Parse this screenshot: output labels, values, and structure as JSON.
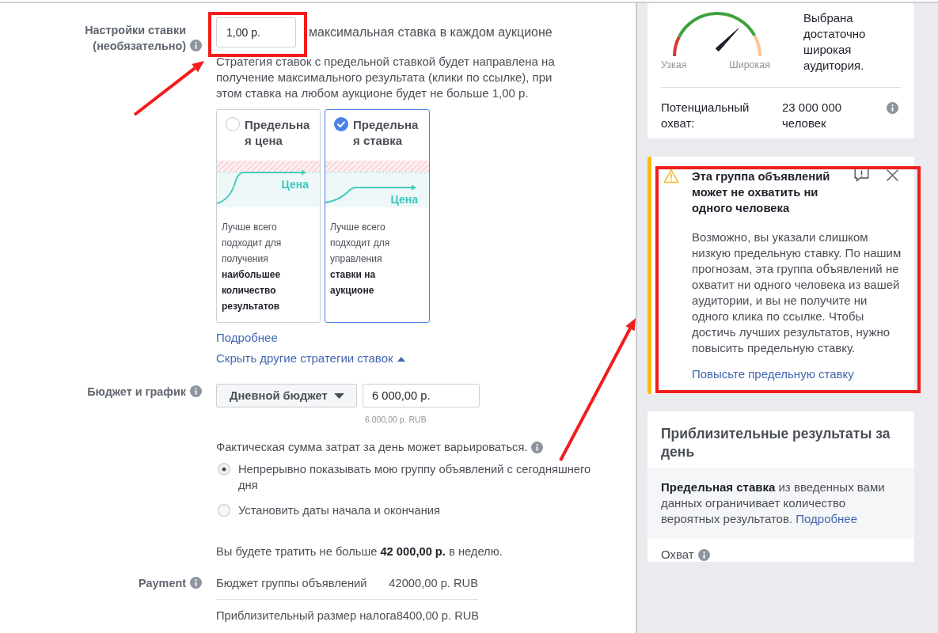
{
  "bid_settings": {
    "label": "Настройки ставки (необязательно)",
    "bid": {
      "value": "1,00 р.",
      "highlighted": true
    },
    "bid_caption": "максимальная ставка в каждом аукционе",
    "description": "Стратегия ставок с предельной ставкой будет направлена на получение максимального результата (клики по ссылке), при этом ставка на любом аукционе будет не больше 1,00 р.",
    "strategies": [
      {
        "kind": "cost_cap",
        "title": "Предельная цена",
        "selected": false,
        "curve_label": "Цена",
        "description": "Лучше всего подходит для получения **наибольшее количество результатов**"
      },
      {
        "kind": "bid_cap",
        "title": "Предельная ставка",
        "selected": true,
        "curve_label": "Цена",
        "description": "Лучше всего подходит для управления **ставки на аукционе**"
      }
    ],
    "learn_more_link": "Подробнее",
    "hide_strategies_link": "Скрыть другие стратегии ставок"
  },
  "budget": {
    "label": "Бюджет и график",
    "budget_type": "Дневной бюджет",
    "amount": "6 000,00 р.",
    "amount_hint": "6 000,00 р. RUB",
    "note": "Фактическая сумма затрат за день может варьироваться.",
    "schedule_options": [
      {
        "label": "Непрерывно показывать мою группу объявлений с сегодняшнего дня",
        "selected": true
      },
      {
        "label": "Установить даты начала и окончания",
        "selected": false
      }
    ],
    "weekly_total": "Вы будете тратить не больше **42 000,00 р.** в неделю."
  },
  "payment": {
    "label": "Payment",
    "rows": [
      {
        "label": "Бюджет группы объявлений",
        "value": "42000,00 р. RUB"
      },
      {
        "label": "Приблизительный размер налога",
        "value": "8400,00 р. RUB"
      }
    ]
  },
  "audience": {
    "gauge": {
      "level": 0.75,
      "min_label": "Узкая",
      "max_label": "Широкая"
    },
    "verdict": "Выбрана достаточно широкая аудитория.",
    "reach_label": "Потенциальный охват:",
    "reach_value": "23 000 000 человек"
  },
  "warning": {
    "highlighted": true,
    "title": "Эта группа объявлений может не охватить ни одного человека",
    "body": "Возможно, вы указали слишком низкую предельную ставку. По нашим прогнозам, эта группа объявлений не охватит ни одного человека из вашей аудитории, и вы не получите ни одного клика по ссылке. Чтобы достичь лучших результатов, нужно повысить предельную ставку.",
    "link": "Повысьте предельную ставку"
  },
  "estimates": {
    "title": "Приблизительные результаты за день",
    "notice": "**Предельная ставка** из введенных вами данных ограничивает количество вероятных результатов.",
    "notice_link": "Подробнее",
    "metric_label": "Охват"
  }
}
